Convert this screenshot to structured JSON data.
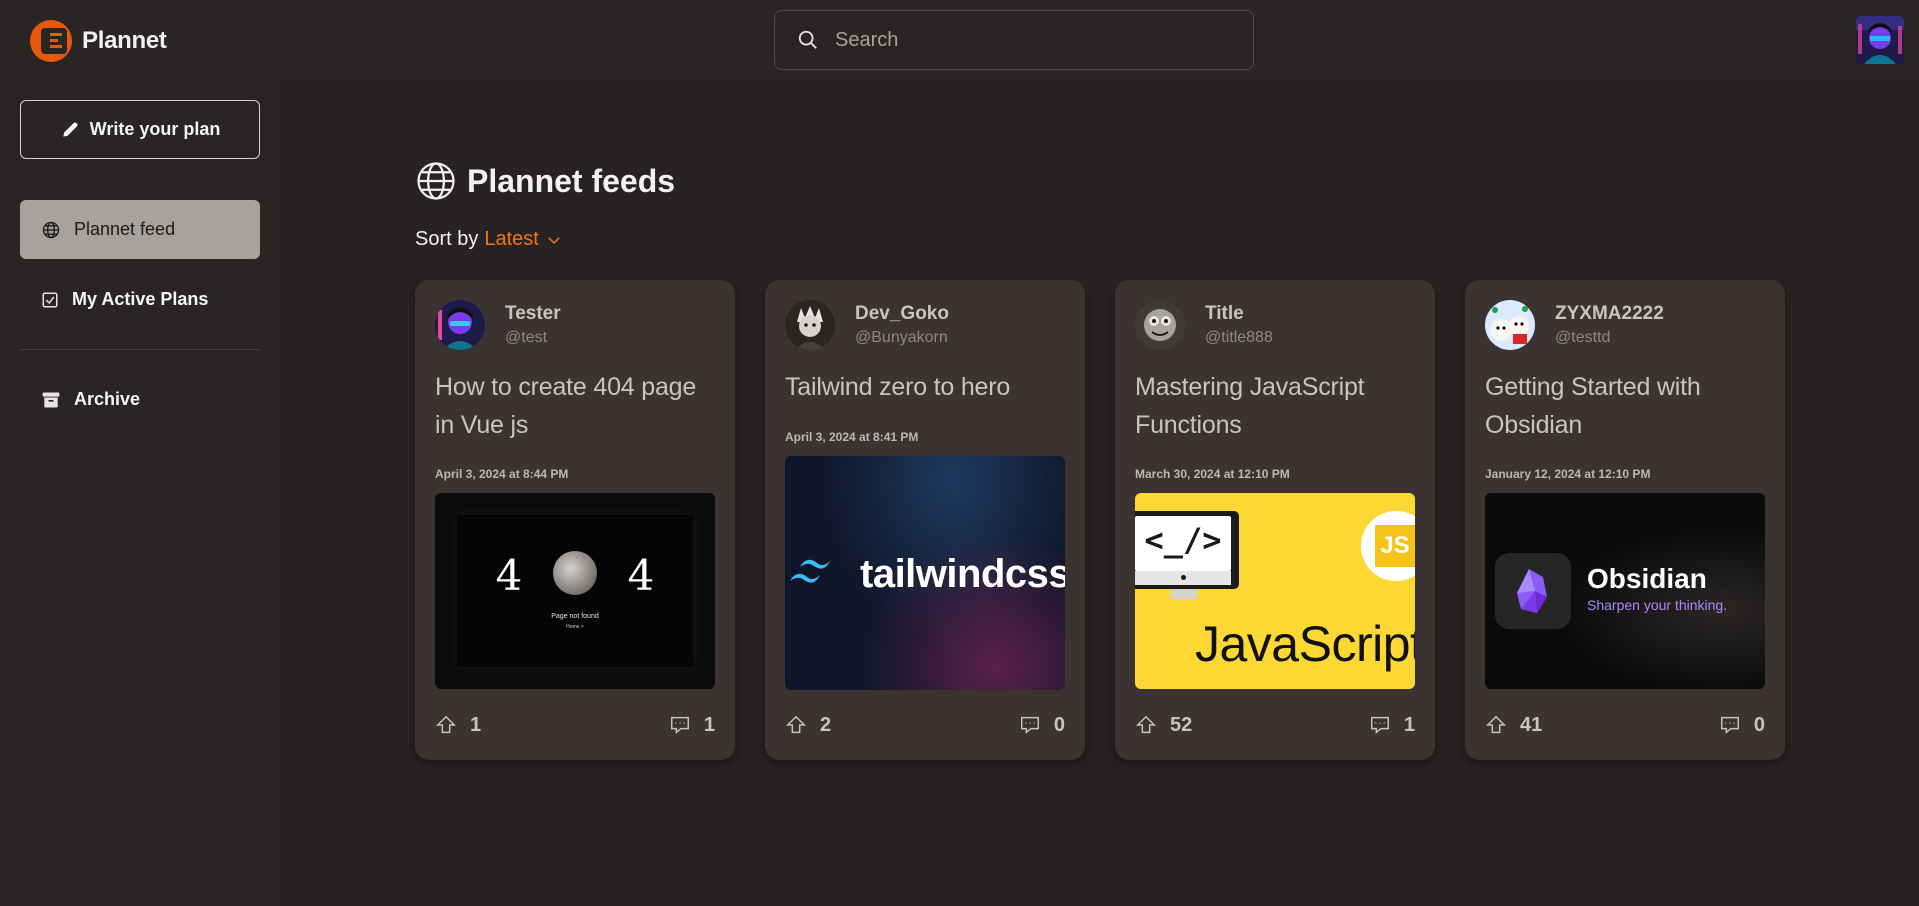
{
  "app": {
    "name": "Plannet"
  },
  "search": {
    "placeholder": "Search",
    "value": ""
  },
  "sidebar": {
    "write_label": "Write your plan",
    "items": [
      {
        "label": "Plannet feed",
        "active": true
      },
      {
        "label": "My Active Plans",
        "active": false
      },
      {
        "label": "Archive",
        "active": false
      }
    ]
  },
  "main": {
    "title": "Plannet feeds",
    "sort_label": "Sort by",
    "sort_value": "Latest"
  },
  "cards": [
    {
      "name": "Tester",
      "handle": "@test",
      "title": "How to create 404 page in Vue js",
      "date": "April 3, 2024 at 8:44 PM",
      "thumb": {
        "big": "4 4",
        "line1": "Page not found",
        "line2": "Home >"
      },
      "upvotes": "1",
      "comments": "1"
    },
    {
      "name": "Dev_Goko",
      "handle": "@Bunyakorn",
      "title": "Tailwind zero to hero",
      "date": "April 3, 2024 at 8:41 PM",
      "thumb": {
        "text": "tailwindcss"
      },
      "upvotes": "2",
      "comments": "0"
    },
    {
      "name": "Title",
      "handle": "@title888",
      "title": "Mastering JavaScript Functions",
      "date": "March 30, 2024 at 12:10 PM",
      "thumb": {
        "code": "<_/>",
        "text": "JavaScript",
        "badge": "JS"
      },
      "upvotes": "52",
      "comments": "1"
    },
    {
      "name": "ZYXMA2222",
      "handle": "@testtd",
      "title": "Getting Started with Obsidian",
      "date": "January 12, 2024 at 12:10 PM",
      "thumb": {
        "text": "Obsidian",
        "tagline": "Sharpen your thinking."
      },
      "upvotes": "41",
      "comments": "0"
    }
  ],
  "colors": {
    "accent": "#f97316",
    "brand": "#ea580c",
    "bg": "#262322",
    "card": "#3a3331"
  }
}
